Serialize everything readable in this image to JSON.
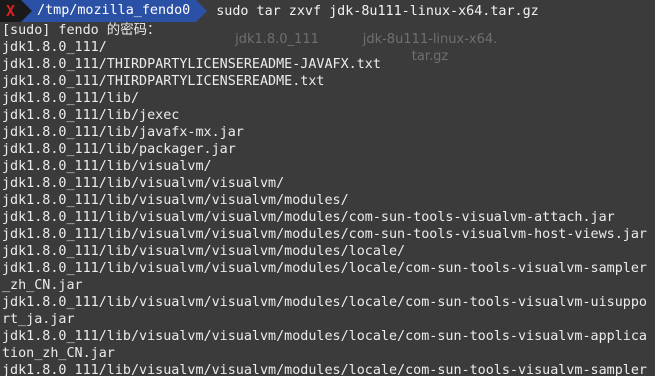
{
  "prompt": {
    "status_glyph": "X",
    "path": "/tmp/mozilla_fendo0",
    "command": "sudo tar zxvf jdk-8u111-linux-x64.tar.gz"
  },
  "background_files": [
    {
      "name": "jdk1.8.0_111"
    },
    {
      "name": "jdk-8u111-linux-x64.\ntar.gz"
    }
  ],
  "output_lines": [
    "[sudo] fendo 的密码：",
    "jdk1.8.0_111/",
    "jdk1.8.0_111/THIRDPARTYLICENSEREADME-JAVAFX.txt",
    "jdk1.8.0_111/THIRDPARTYLICENSEREADME.txt",
    "jdk1.8.0_111/lib/",
    "jdk1.8.0_111/lib/jexec",
    "jdk1.8.0_111/lib/javafx-mx.jar",
    "jdk1.8.0_111/lib/packager.jar",
    "jdk1.8.0_111/lib/visualvm/",
    "jdk1.8.0_111/lib/visualvm/visualvm/",
    "jdk1.8.0_111/lib/visualvm/visualvm/modules/",
    "jdk1.8.0_111/lib/visualvm/visualvm/modules/com-sun-tools-visualvm-attach.jar",
    "jdk1.8.0_111/lib/visualvm/visualvm/modules/com-sun-tools-visualvm-host-views.jar",
    "jdk1.8.0_111/lib/visualvm/visualvm/modules/locale/",
    "jdk1.8.0_111/lib/visualvm/visualvm/modules/locale/com-sun-tools-visualvm-sampler",
    "_zh_CN.jar",
    "jdk1.8.0_111/lib/visualvm/visualvm/modules/locale/com-sun-tools-visualvm-uisuppo",
    "rt_ja.jar",
    "jdk1.8.0_111/lib/visualvm/visualvm/modules/locale/com-sun-tools-visualvm-applica",
    "tion_zh_CN.jar",
    "jdk1.8.0_111/lib/visualvm/visualvm/modules/locale/com-sun-tools-visualvm-sampler"
  ],
  "colors": {
    "background": "#3b3b3b",
    "text": "#ececec",
    "status_segment_bg": "#1a1a1a",
    "status_glyph": "#e02020",
    "path_segment_bg": "#2b51a6"
  }
}
